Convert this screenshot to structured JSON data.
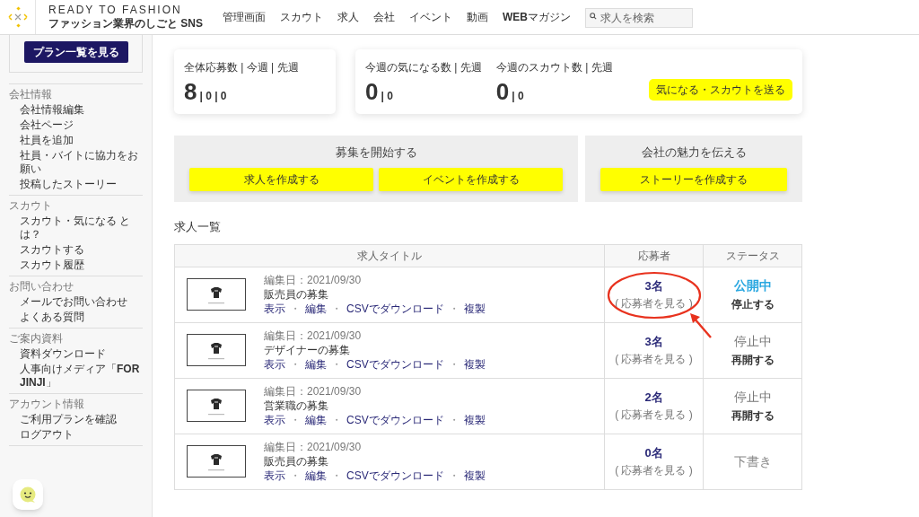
{
  "header": {
    "title": "READY TO FASHION",
    "subtitle": "ファッション業界のしごと SNS",
    "nav": [
      "管理画面",
      "スカウト",
      "求人",
      "会社",
      "イベント",
      "動画",
      "**WEB**マガジン"
    ],
    "search": {
      "placeholder": "求人を検索"
    }
  },
  "sidebar": {
    "plan_button": "プラン一覧を見る",
    "sections": [
      {
        "title": "会社情報",
        "items": [
          "会社情報編集",
          "会社ページ",
          "社員を追加",
          "社員・バイトに協力をお願い",
          "投稿したストーリー"
        ]
      },
      {
        "title": "スカウト",
        "items": [
          "スカウト・気になる とは？",
          "スカウトする",
          "スカウト履歴"
        ]
      },
      {
        "title": "お問い合わせ",
        "items": [
          "メールでお問い合わせ",
          "よくある質問"
        ]
      },
      {
        "title": "ご案内資料",
        "items": [
          "資料ダウンロード",
          "人事向けメディア「**FOR JINJI**」"
        ]
      },
      {
        "title": "アカウント情報",
        "items": [
          "ご利用プランを確認",
          "ログアウト"
        ]
      }
    ]
  },
  "stats": [
    {
      "title": "全体応募数 | 今週 | 先週",
      "value": "8",
      "sub": "| 0 | 0"
    }
  ],
  "stats_wide": {
    "items": [
      {
        "title": "今週の気になる数 | 先週",
        "value": "0",
        "sub": "| 0"
      },
      {
        "title": "今週のスカウト数 | 先週",
        "value": "0",
        "sub": "| 0"
      }
    ],
    "button": "気になる・スカウトを送る"
  },
  "panels": [
    {
      "title": "募集を開始する",
      "buttons": [
        "求人を作成する",
        "イベントを作成する"
      ]
    },
    {
      "title": "会社の魅力を伝える",
      "buttons": [
        "ストーリーを作成する"
      ]
    }
  ],
  "jobs": {
    "title": "求人一覧",
    "columns": [
      "求人タイトル",
      "応募者",
      "ステータス"
    ],
    "rows": [
      {
        "edited": "編集日：2021/09/30",
        "name": "販売員の募集",
        "links": [
          {
            "kind": "link",
            "text": "表示"
          },
          {
            "kind": "sep",
            "text": "・"
          },
          {
            "kind": "link",
            "text": "編集"
          },
          {
            "kind": "sep",
            "text": "・"
          },
          {
            "kind": "link",
            "text": "CSVでダウンロード"
          },
          {
            "kind": "sep",
            "text": "・"
          },
          {
            "kind": "link",
            "text": "複製"
          }
        ],
        "count": "3名",
        "view": "( 応募者を見る )",
        "highlighted": true,
        "status": {
          "kind": "public",
          "label": "公開中"
        },
        "action": "停止する"
      },
      {
        "edited": "編集日：2021/09/30",
        "name": "デザイナーの募集",
        "links": [
          {
            "kind": "link",
            "text": "表示"
          },
          {
            "kind": "sep",
            "text": "・"
          },
          {
            "kind": "link",
            "text": "編集"
          },
          {
            "kind": "sep",
            "text": "・"
          },
          {
            "kind": "link",
            "text": "CSVでダウンロード"
          },
          {
            "kind": "sep",
            "text": "・"
          },
          {
            "kind": "link",
            "text": "複製"
          }
        ],
        "count": "3名",
        "view": "( 応募者を見る )",
        "highlighted": false,
        "status": {
          "kind": "stopped",
          "label": "停止中"
        },
        "action": "再開する"
      },
      {
        "edited": "編集日：2021/09/30",
        "name": "営業職の募集",
        "links": [
          {
            "kind": "link",
            "text": "表示"
          },
          {
            "kind": "sep",
            "text": "・"
          },
          {
            "kind": "link",
            "text": "編集"
          },
          {
            "kind": "sep",
            "text": "・"
          },
          {
            "kind": "link",
            "text": "CSVでダウンロード"
          },
          {
            "kind": "sep",
            "text": "・"
          },
          {
            "kind": "link",
            "text": "複製"
          }
        ],
        "count": "2名",
        "view": "( 応募者を見る )",
        "highlighted": false,
        "status": {
          "kind": "stopped",
          "label": "停止中"
        },
        "action": "再開する"
      },
      {
        "edited": "編集日：2021/09/30",
        "name": "販売員の募集",
        "links": [
          {
            "kind": "link",
            "text": "表示"
          },
          {
            "kind": "sep",
            "text": "・"
          },
          {
            "kind": "link",
            "text": "編集"
          },
          {
            "kind": "sep",
            "text": "・"
          },
          {
            "kind": "link",
            "text": "CSVでダウンロード"
          },
          {
            "kind": "sep",
            "text": "・"
          },
          {
            "kind": "link",
            "text": "複製"
          }
        ],
        "count": "0名",
        "view": "( 応募者を見る )",
        "highlighted": false,
        "status": {
          "kind": "draft",
          "label": "下書き"
        }
      }
    ]
  }
}
